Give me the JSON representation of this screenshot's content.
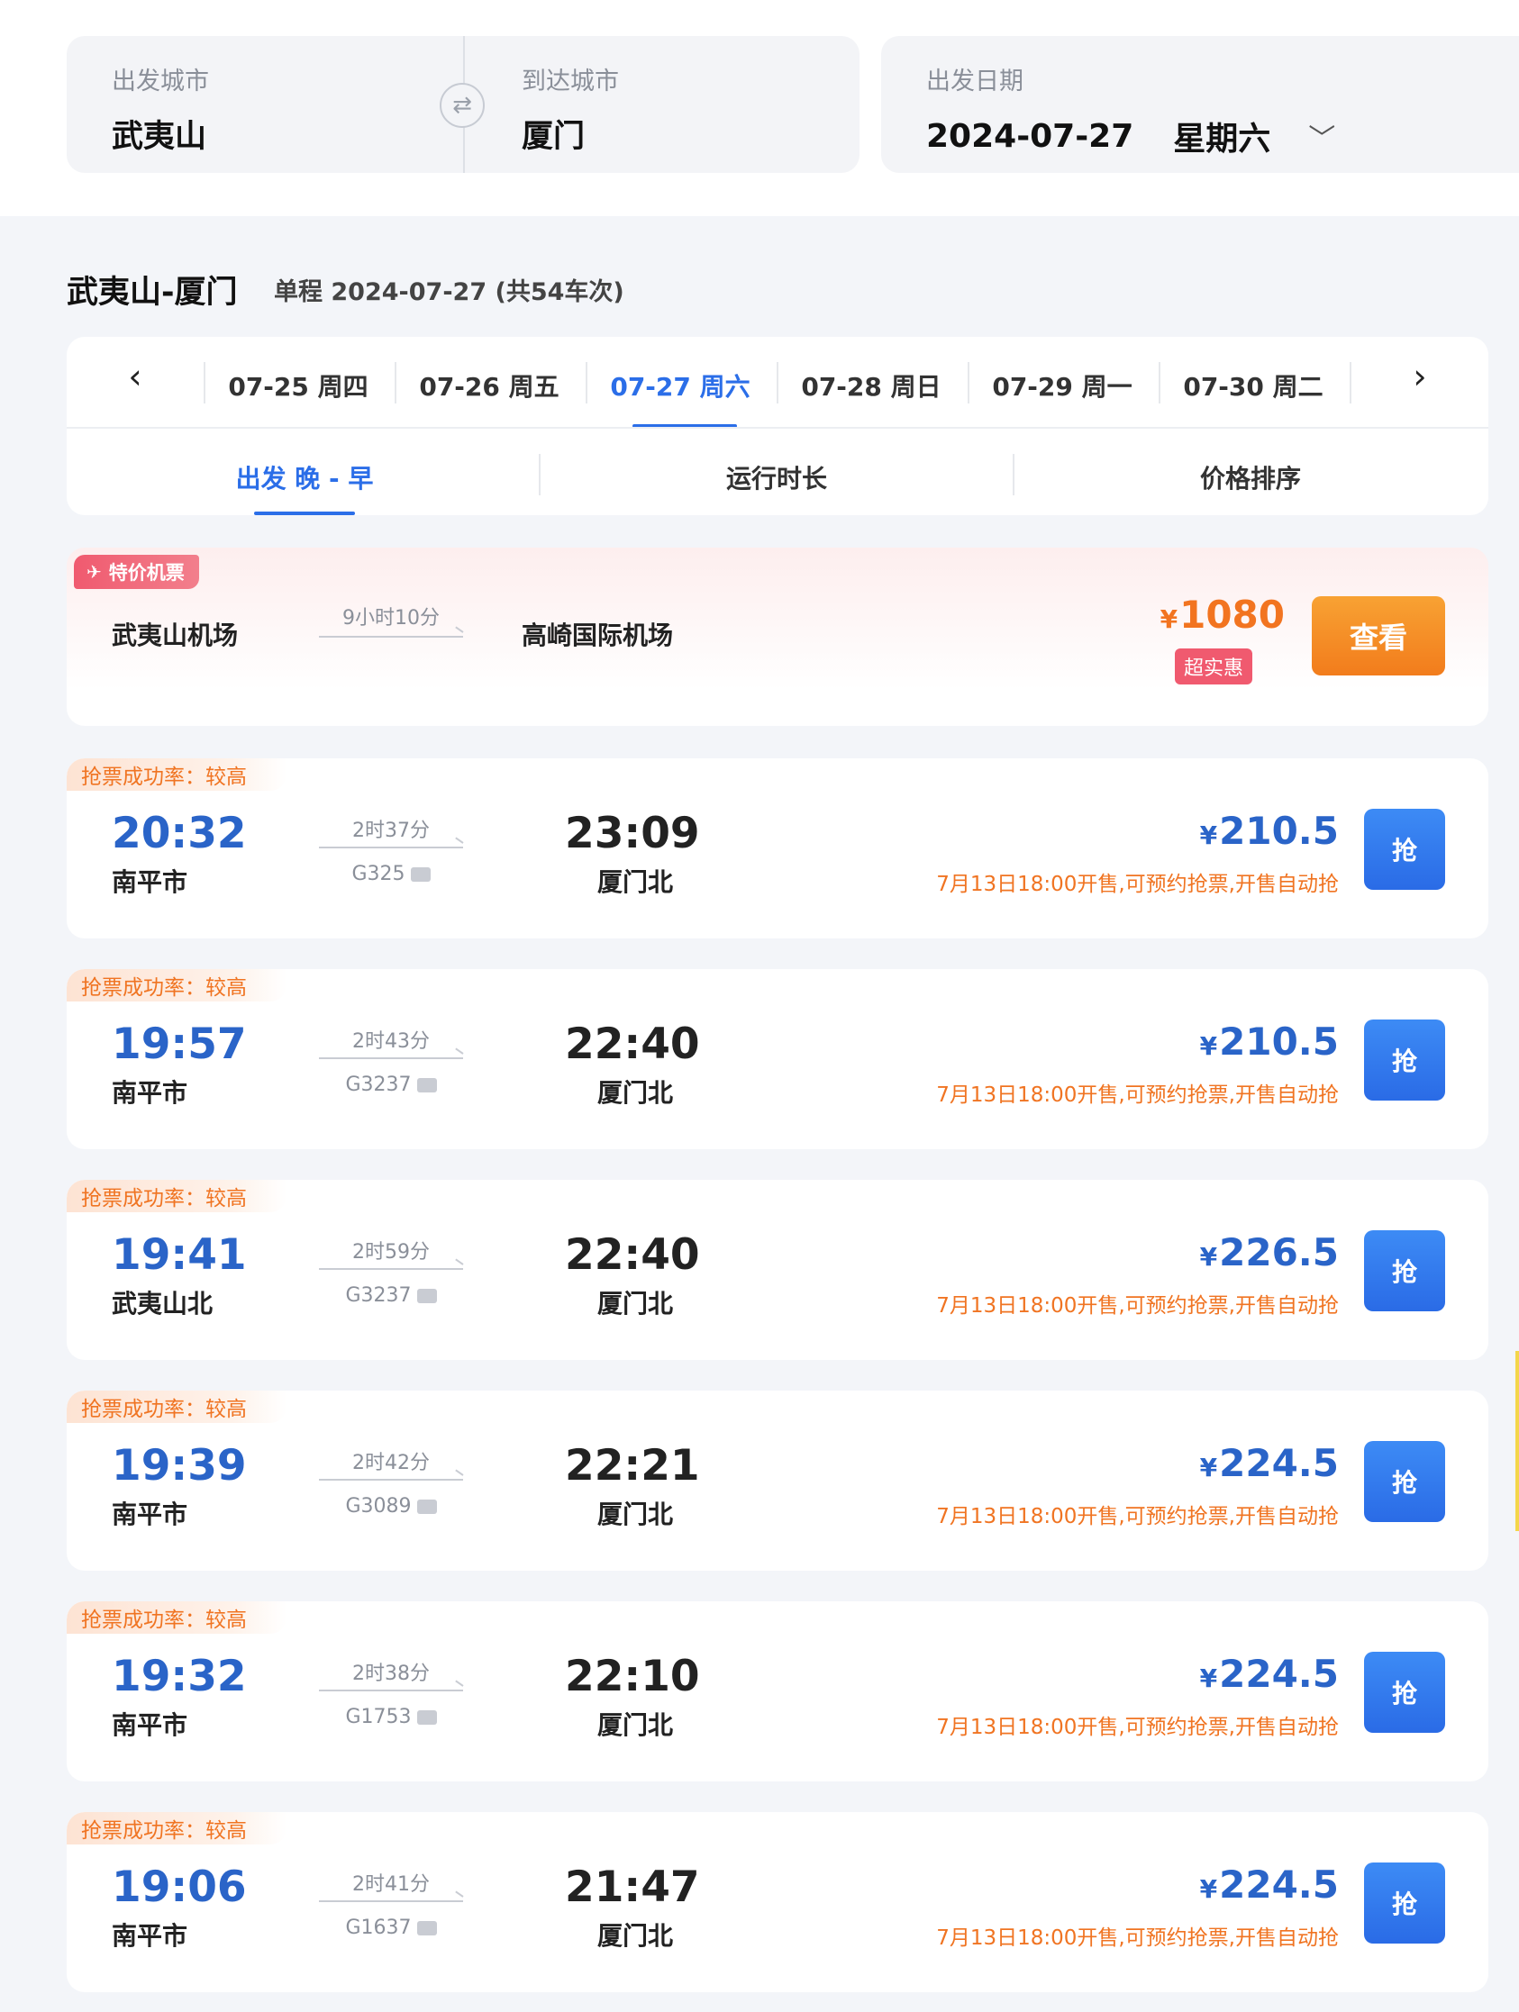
{
  "search": {
    "from_label": "出发城市",
    "from_city": "武夷山",
    "to_label": "到达城市",
    "to_city": "厦门",
    "swap_icon": "⇄",
    "date_label": "出发日期",
    "date": "2024-07-27",
    "weekday": "星期六",
    "chevron": "﹀"
  },
  "route": {
    "title": "武夷山-厦门",
    "summary": "单程 2024-07-27 (共54车次)"
  },
  "date_tabs": {
    "prev": "‹",
    "next": "›",
    "items": [
      {
        "label": "07-25  周四"
      },
      {
        "label": "07-26  周五"
      },
      {
        "label": "07-27  周六"
      },
      {
        "label": "07-28  周日"
      },
      {
        "label": "07-29  周一"
      },
      {
        "label": "07-30  周二"
      }
    ],
    "active_index": 2
  },
  "sort_tabs": [
    {
      "label": "出发  晚 - 早"
    },
    {
      "label": "运行时长"
    },
    {
      "label": "价格排序"
    }
  ],
  "flight": {
    "badge": "特价机票",
    "from": "武夷山机场",
    "duration": "9小时10分",
    "to": "高崎国际机场",
    "currency": "¥",
    "price": "1080",
    "tag": "超实惠",
    "button": "查看"
  },
  "trains": [
    {
      "rate": "抢票成功率：较高",
      "dep_time": "20:32",
      "dep_station": "南平市",
      "duration": "2时37分",
      "code": "G325",
      "arr_time": "23:09",
      "arr_station": "厦门北",
      "currency": "¥",
      "price": "210.5",
      "note": "7月13日18:00开售,可预约抢票,开售自动抢",
      "button": "抢"
    },
    {
      "rate": "抢票成功率：较高",
      "dep_time": "19:57",
      "dep_station": "南平市",
      "duration": "2时43分",
      "code": "G3237",
      "arr_time": "22:40",
      "arr_station": "厦门北",
      "currency": "¥",
      "price": "210.5",
      "note": "7月13日18:00开售,可预约抢票,开售自动抢",
      "button": "抢"
    },
    {
      "rate": "抢票成功率：较高",
      "dep_time": "19:41",
      "dep_station": "武夷山北",
      "duration": "2时59分",
      "code": "G3237",
      "arr_time": "22:40",
      "arr_station": "厦门北",
      "currency": "¥",
      "price": "226.5",
      "note": "7月13日18:00开售,可预约抢票,开售自动抢",
      "button": "抢"
    },
    {
      "rate": "抢票成功率：较高",
      "dep_time": "19:39",
      "dep_station": "南平市",
      "duration": "2时42分",
      "code": "G3089",
      "arr_time": "22:21",
      "arr_station": "厦门北",
      "currency": "¥",
      "price": "224.5",
      "note": "7月13日18:00开售,可预约抢票,开售自动抢",
      "button": "抢"
    },
    {
      "rate": "抢票成功率：较高",
      "dep_time": "19:32",
      "dep_station": "南平市",
      "duration": "2时38分",
      "code": "G1753",
      "arr_time": "22:10",
      "arr_station": "厦门北",
      "currency": "¥",
      "price": "224.5",
      "note": "7月13日18:00开售,可预约抢票,开售自动抢",
      "button": "抢"
    },
    {
      "rate": "抢票成功率：较高",
      "dep_time": "19:06",
      "dep_station": "南平市",
      "duration": "2时41分",
      "code": "G1637",
      "arr_time": "21:47",
      "arr_station": "厦门北",
      "currency": "¥",
      "price": "224.5",
      "note": "7月13日18:00开售,可预约抢票,开售自动抢",
      "button": "抢"
    }
  ]
}
